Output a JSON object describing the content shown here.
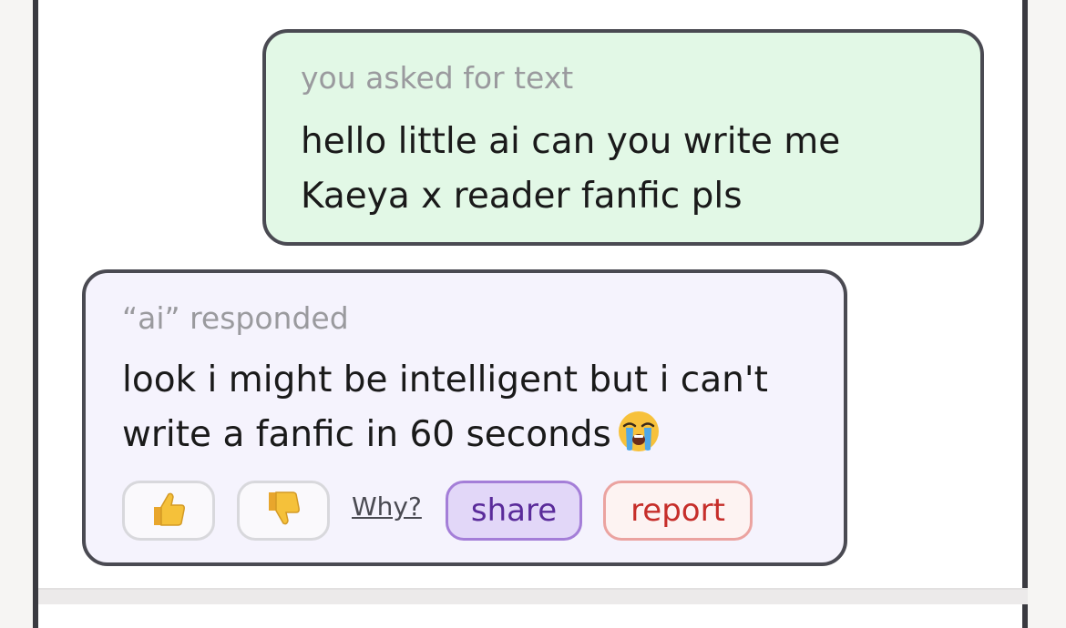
{
  "conversation": {
    "user": {
      "label": "you asked for text",
      "line1": "hello little ai can you write me",
      "line2": "Kaeya x reader fanfic pls"
    },
    "ai": {
      "label": "“ai” responded",
      "line1": "look i might be intelligent but i can't",
      "line2": "write a fanfic in 60 seconds",
      "emoji": "loudly-crying-face-icon"
    }
  },
  "actions": {
    "thumbs_up_icon": "thumbs-up-icon",
    "thumbs_down_icon": "thumbs-down-icon",
    "why_label": "Why?",
    "share_label": "share",
    "report_label": "report"
  },
  "colors": {
    "user_bubble": "#e2f8e6",
    "ai_bubble": "#f5f3fd",
    "border": "#4a4a52",
    "share_accent": "#a47ed8",
    "report_accent": "#c62e2a"
  }
}
